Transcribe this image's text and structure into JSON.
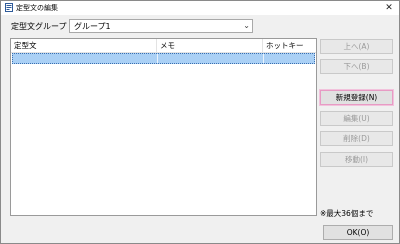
{
  "window": {
    "title": "定型文の編集",
    "close_glyph": "✕"
  },
  "group": {
    "label": "定型文グループ",
    "selected": "グループ1",
    "arrow": "⌄"
  },
  "list": {
    "columns": [
      "定型文",
      "メモ",
      "ホットキー"
    ],
    "rows": [
      [
        "",
        "",
        ""
      ]
    ]
  },
  "buttons": {
    "up": "上へ(A)",
    "down": "下へ(B)",
    "new": "新規登録(N)",
    "edit": "編集(U)",
    "delete": "削除(D)",
    "move": "移動(I)"
  },
  "note": "※最大36個まで",
  "ok": "OK(O)",
  "colors": {
    "selection": "#aad0f5",
    "focus": "#e79bc4",
    "window_bg": "#f0f0f0"
  }
}
